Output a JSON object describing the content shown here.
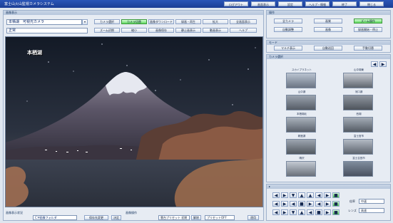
{
  "app": {
    "title": "富士山火山監視カメラシステム"
  },
  "topbar": {
    "buttons": [
      "ログアウト",
      "画面表示",
      "設定",
      "ヘルプ・情報",
      "終了",
      "閉じる"
    ]
  },
  "left": {
    "section_label": "画像表示",
    "camera_field": "本栖湖　可視光カメラ",
    "status_field": "正常",
    "row1_buttons": [
      "カメラ選択",
      "カメラ切替",
      "画像ダウンロード",
      "録画・再生",
      "拡大",
      "全画面表示"
    ],
    "row2_buttons": [
      "ズーム初期",
      "縮小",
      "画像保存",
      "静止画表示",
      "動画表示",
      "ヘルプ"
    ],
    "overlay_label": "本栖湖",
    "bottom": {
      "left_label": "画像表示状況",
      "path_value": "C:¥画像フォルダ",
      "browse_button": "保存先変更",
      "ok_button": "決定",
      "ptz_label": "画像操作",
      "preset_select": "雲台プリセット 初期",
      "preset_button": "解除",
      "mode_select": "プリセットOFF",
      "apply_button": "適用"
    }
  },
  "right": {
    "operate_header": "操作",
    "operate_buttons": [
      "全カメラ",
      "画質",
      "ズーム操作",
      "自動調整",
      "画像",
      "録画開始・停止"
    ],
    "mode_header": "モード",
    "mode_buttons": [
      "マルチ表示",
      "自動巡回",
      "手動切替"
    ],
    "camera_header": "カメラ選択",
    "cameras": [
      "スカイプラネット",
      "山中湖東",
      "山中湖",
      "河口湖",
      "本栖湖北",
      "西湖",
      "精進湖",
      "富士宮市",
      "鳴沢",
      "富士吉田市",
      "御殿場",
      "富士宮"
    ],
    "ptz_header": "カメラ制御",
    "zoom_label": "倍率",
    "zoom_value": "中速",
    "focus_label": "レンズ",
    "focus_value": "高速"
  }
}
